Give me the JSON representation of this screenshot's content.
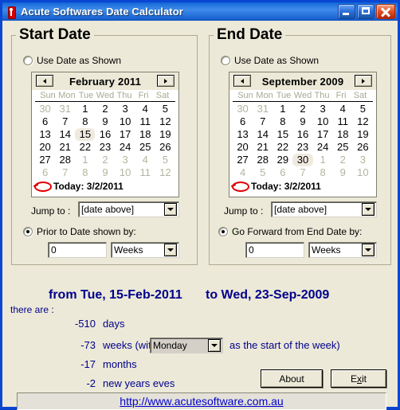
{
  "window": {
    "title": "Acute Softwares Date Calculator",
    "icon": "app-icon",
    "buttons": {
      "minimize": "minimize",
      "maximize": "maximize",
      "close": "close"
    }
  },
  "start_panel": {
    "title": "Start Date",
    "use_date_label": "Use Date as Shown",
    "use_date_selected": false,
    "calendar": {
      "month_title": "February 2011",
      "prev": "prev-month",
      "next": "next-month",
      "dow": [
        "Sun",
        "Mon",
        "Tue",
        "Wed",
        "Thu",
        "Fri",
        "Sat"
      ],
      "weeks": [
        [
          {
            "d": "30",
            "s": "dim"
          },
          {
            "d": "31",
            "s": "dim"
          },
          {
            "d": "1",
            "s": ""
          },
          {
            "d": "2",
            "s": ""
          },
          {
            "d": "3",
            "s": ""
          },
          {
            "d": "4",
            "s": ""
          },
          {
            "d": "5",
            "s": ""
          }
        ],
        [
          {
            "d": "6",
            "s": ""
          },
          {
            "d": "7",
            "s": ""
          },
          {
            "d": "8",
            "s": ""
          },
          {
            "d": "9",
            "s": ""
          },
          {
            "d": "10",
            "s": ""
          },
          {
            "d": "11",
            "s": ""
          },
          {
            "d": "12",
            "s": ""
          }
        ],
        [
          {
            "d": "13",
            "s": ""
          },
          {
            "d": "14",
            "s": ""
          },
          {
            "d": "15",
            "s": "sel"
          },
          {
            "d": "16",
            "s": ""
          },
          {
            "d": "17",
            "s": ""
          },
          {
            "d": "18",
            "s": ""
          },
          {
            "d": "19",
            "s": ""
          }
        ],
        [
          {
            "d": "20",
            "s": ""
          },
          {
            "d": "21",
            "s": ""
          },
          {
            "d": "22",
            "s": ""
          },
          {
            "d": "23",
            "s": ""
          },
          {
            "d": "24",
            "s": ""
          },
          {
            "d": "25",
            "s": ""
          },
          {
            "d": "26",
            "s": ""
          }
        ],
        [
          {
            "d": "27",
            "s": ""
          },
          {
            "d": "28",
            "s": ""
          },
          {
            "d": "1",
            "s": "dim"
          },
          {
            "d": "2",
            "s": "dim"
          },
          {
            "d": "3",
            "s": "dim"
          },
          {
            "d": "4",
            "s": "dim"
          },
          {
            "d": "5",
            "s": "dim"
          }
        ],
        [
          {
            "d": "6",
            "s": "dim"
          },
          {
            "d": "7",
            "s": "dim"
          },
          {
            "d": "8",
            "s": "dim"
          },
          {
            "d": "9",
            "s": "dim"
          },
          {
            "d": "10",
            "s": "dim"
          },
          {
            "d": "11",
            "s": "dim"
          },
          {
            "d": "12",
            "s": "dim"
          }
        ]
      ],
      "today_label": "Today: 3/2/2011"
    },
    "jump_label": "Jump to :",
    "jump_value": "[date above]",
    "offset_label": "Prior to Date shown by:",
    "offset_selected": true,
    "offset_value": "0",
    "offset_unit": "Weeks"
  },
  "end_panel": {
    "title": "End Date",
    "use_date_label": "Use Date as Shown",
    "use_date_selected": false,
    "calendar": {
      "month_title": "September 2009",
      "prev": "prev-month",
      "next": "next-month",
      "dow": [
        "Sun",
        "Mon",
        "Tue",
        "Wed",
        "Thu",
        "Fri",
        "Sat"
      ],
      "weeks": [
        [
          {
            "d": "30",
            "s": "dim"
          },
          {
            "d": "31",
            "s": "dim"
          },
          {
            "d": "1",
            "s": ""
          },
          {
            "d": "2",
            "s": ""
          },
          {
            "d": "3",
            "s": ""
          },
          {
            "d": "4",
            "s": ""
          },
          {
            "d": "5",
            "s": ""
          }
        ],
        [
          {
            "d": "6",
            "s": ""
          },
          {
            "d": "7",
            "s": ""
          },
          {
            "d": "8",
            "s": ""
          },
          {
            "d": "9",
            "s": ""
          },
          {
            "d": "10",
            "s": ""
          },
          {
            "d": "11",
            "s": ""
          },
          {
            "d": "12",
            "s": ""
          }
        ],
        [
          {
            "d": "13",
            "s": ""
          },
          {
            "d": "14",
            "s": ""
          },
          {
            "d": "15",
            "s": ""
          },
          {
            "d": "16",
            "s": ""
          },
          {
            "d": "17",
            "s": ""
          },
          {
            "d": "18",
            "s": ""
          },
          {
            "d": "19",
            "s": ""
          }
        ],
        [
          {
            "d": "20",
            "s": ""
          },
          {
            "d": "21",
            "s": ""
          },
          {
            "d": "22",
            "s": ""
          },
          {
            "d": "23",
            "s": ""
          },
          {
            "d": "24",
            "s": ""
          },
          {
            "d": "25",
            "s": ""
          },
          {
            "d": "26",
            "s": ""
          }
        ],
        [
          {
            "d": "27",
            "s": ""
          },
          {
            "d": "28",
            "s": ""
          },
          {
            "d": "29",
            "s": ""
          },
          {
            "d": "30",
            "s": "sel"
          },
          {
            "d": "1",
            "s": "dim"
          },
          {
            "d": "2",
            "s": "dim"
          },
          {
            "d": "3",
            "s": "dim"
          }
        ],
        [
          {
            "d": "4",
            "s": "dim"
          },
          {
            "d": "5",
            "s": "dim"
          },
          {
            "d": "6",
            "s": "dim"
          },
          {
            "d": "7",
            "s": "dim"
          },
          {
            "d": "8",
            "s": "dim"
          },
          {
            "d": "9",
            "s": "dim"
          },
          {
            "d": "10",
            "s": "dim"
          }
        ]
      ],
      "today_label": "Today: 3/2/2011"
    },
    "jump_label": "Jump to :",
    "jump_value": "[date above]",
    "offset_label": "Go Forward from End Date by:",
    "offset_selected": true,
    "offset_value": "0",
    "offset_unit": "Weeks"
  },
  "results": {
    "from_text": "from Tue, 15-Feb-2011",
    "to_text": "to Wed, 23-Sep-2009",
    "there_are": "there are :",
    "rows": [
      {
        "num": "-510",
        "label": "days"
      },
      {
        "num": "-73",
        "label": "weeks (with"
      },
      {
        "num": "-17",
        "label": "months"
      },
      {
        "num": "-2",
        "label": "new years eves"
      }
    ],
    "week_start_value": "Monday",
    "week_start_suffix": "as the start of the week)"
  },
  "footer": {
    "about_label": "About",
    "exit_label_pre": "E",
    "exit_label_key": "x",
    "exit_label_post": "it",
    "url": "http://www.acutesoftware.com.au"
  }
}
